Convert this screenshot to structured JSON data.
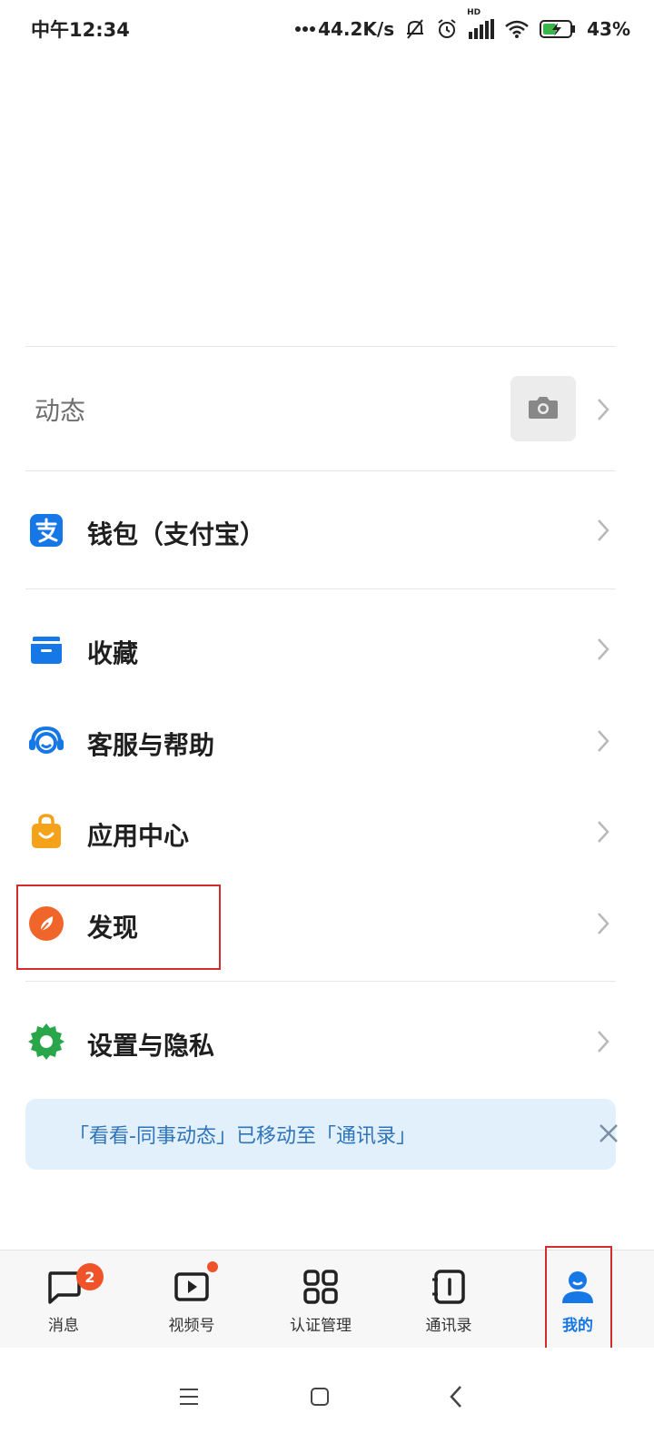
{
  "status_bar": {
    "time": "中午12:34",
    "network_speed": "44.2K/s",
    "battery": "43%",
    "hd_label": "HD",
    "icons": [
      "dots-icon",
      "mute-bell-icon",
      "alarm-icon",
      "signal-icon",
      "wifi-icon",
      "battery-icon"
    ]
  },
  "dongtai": {
    "label": "动态",
    "camera_icon": "camera-icon"
  },
  "menu": {
    "wallet": {
      "label": "钱包（支付宝）",
      "icon": "alipay-icon",
      "color": "#1677e6"
    },
    "favorites": {
      "label": "收藏",
      "icon": "folder-icon",
      "color": "#1677e6"
    },
    "support": {
      "label": "客服与帮助",
      "icon": "headset-icon",
      "color": "#1677e6"
    },
    "app_center": {
      "label": "应用中心",
      "icon": "shopping-bag-icon",
      "color": "#f4a21a"
    },
    "discover": {
      "label": "发现",
      "icon": "compass-icon",
      "color": "#f0652a"
    },
    "settings": {
      "label": "设置与隐私",
      "icon": "gear-icon",
      "color": "#2aa64a"
    }
  },
  "notice": {
    "text": "「看看-同事动态」已移动至「通讯录」"
  },
  "tabs": [
    {
      "label": "消息",
      "icon": "message-icon",
      "badge": "2"
    },
    {
      "label": "视频号",
      "icon": "video-icon",
      "dot": true
    },
    {
      "label": "认证管理",
      "icon": "grid-icon"
    },
    {
      "label": "通讯录",
      "icon": "contacts-icon"
    },
    {
      "label": "我的",
      "icon": "user-icon",
      "active": true
    }
  ],
  "colors": {
    "accent": "#1677e6",
    "highlight_box": "#d32c2c",
    "badge": "#f0532a"
  }
}
